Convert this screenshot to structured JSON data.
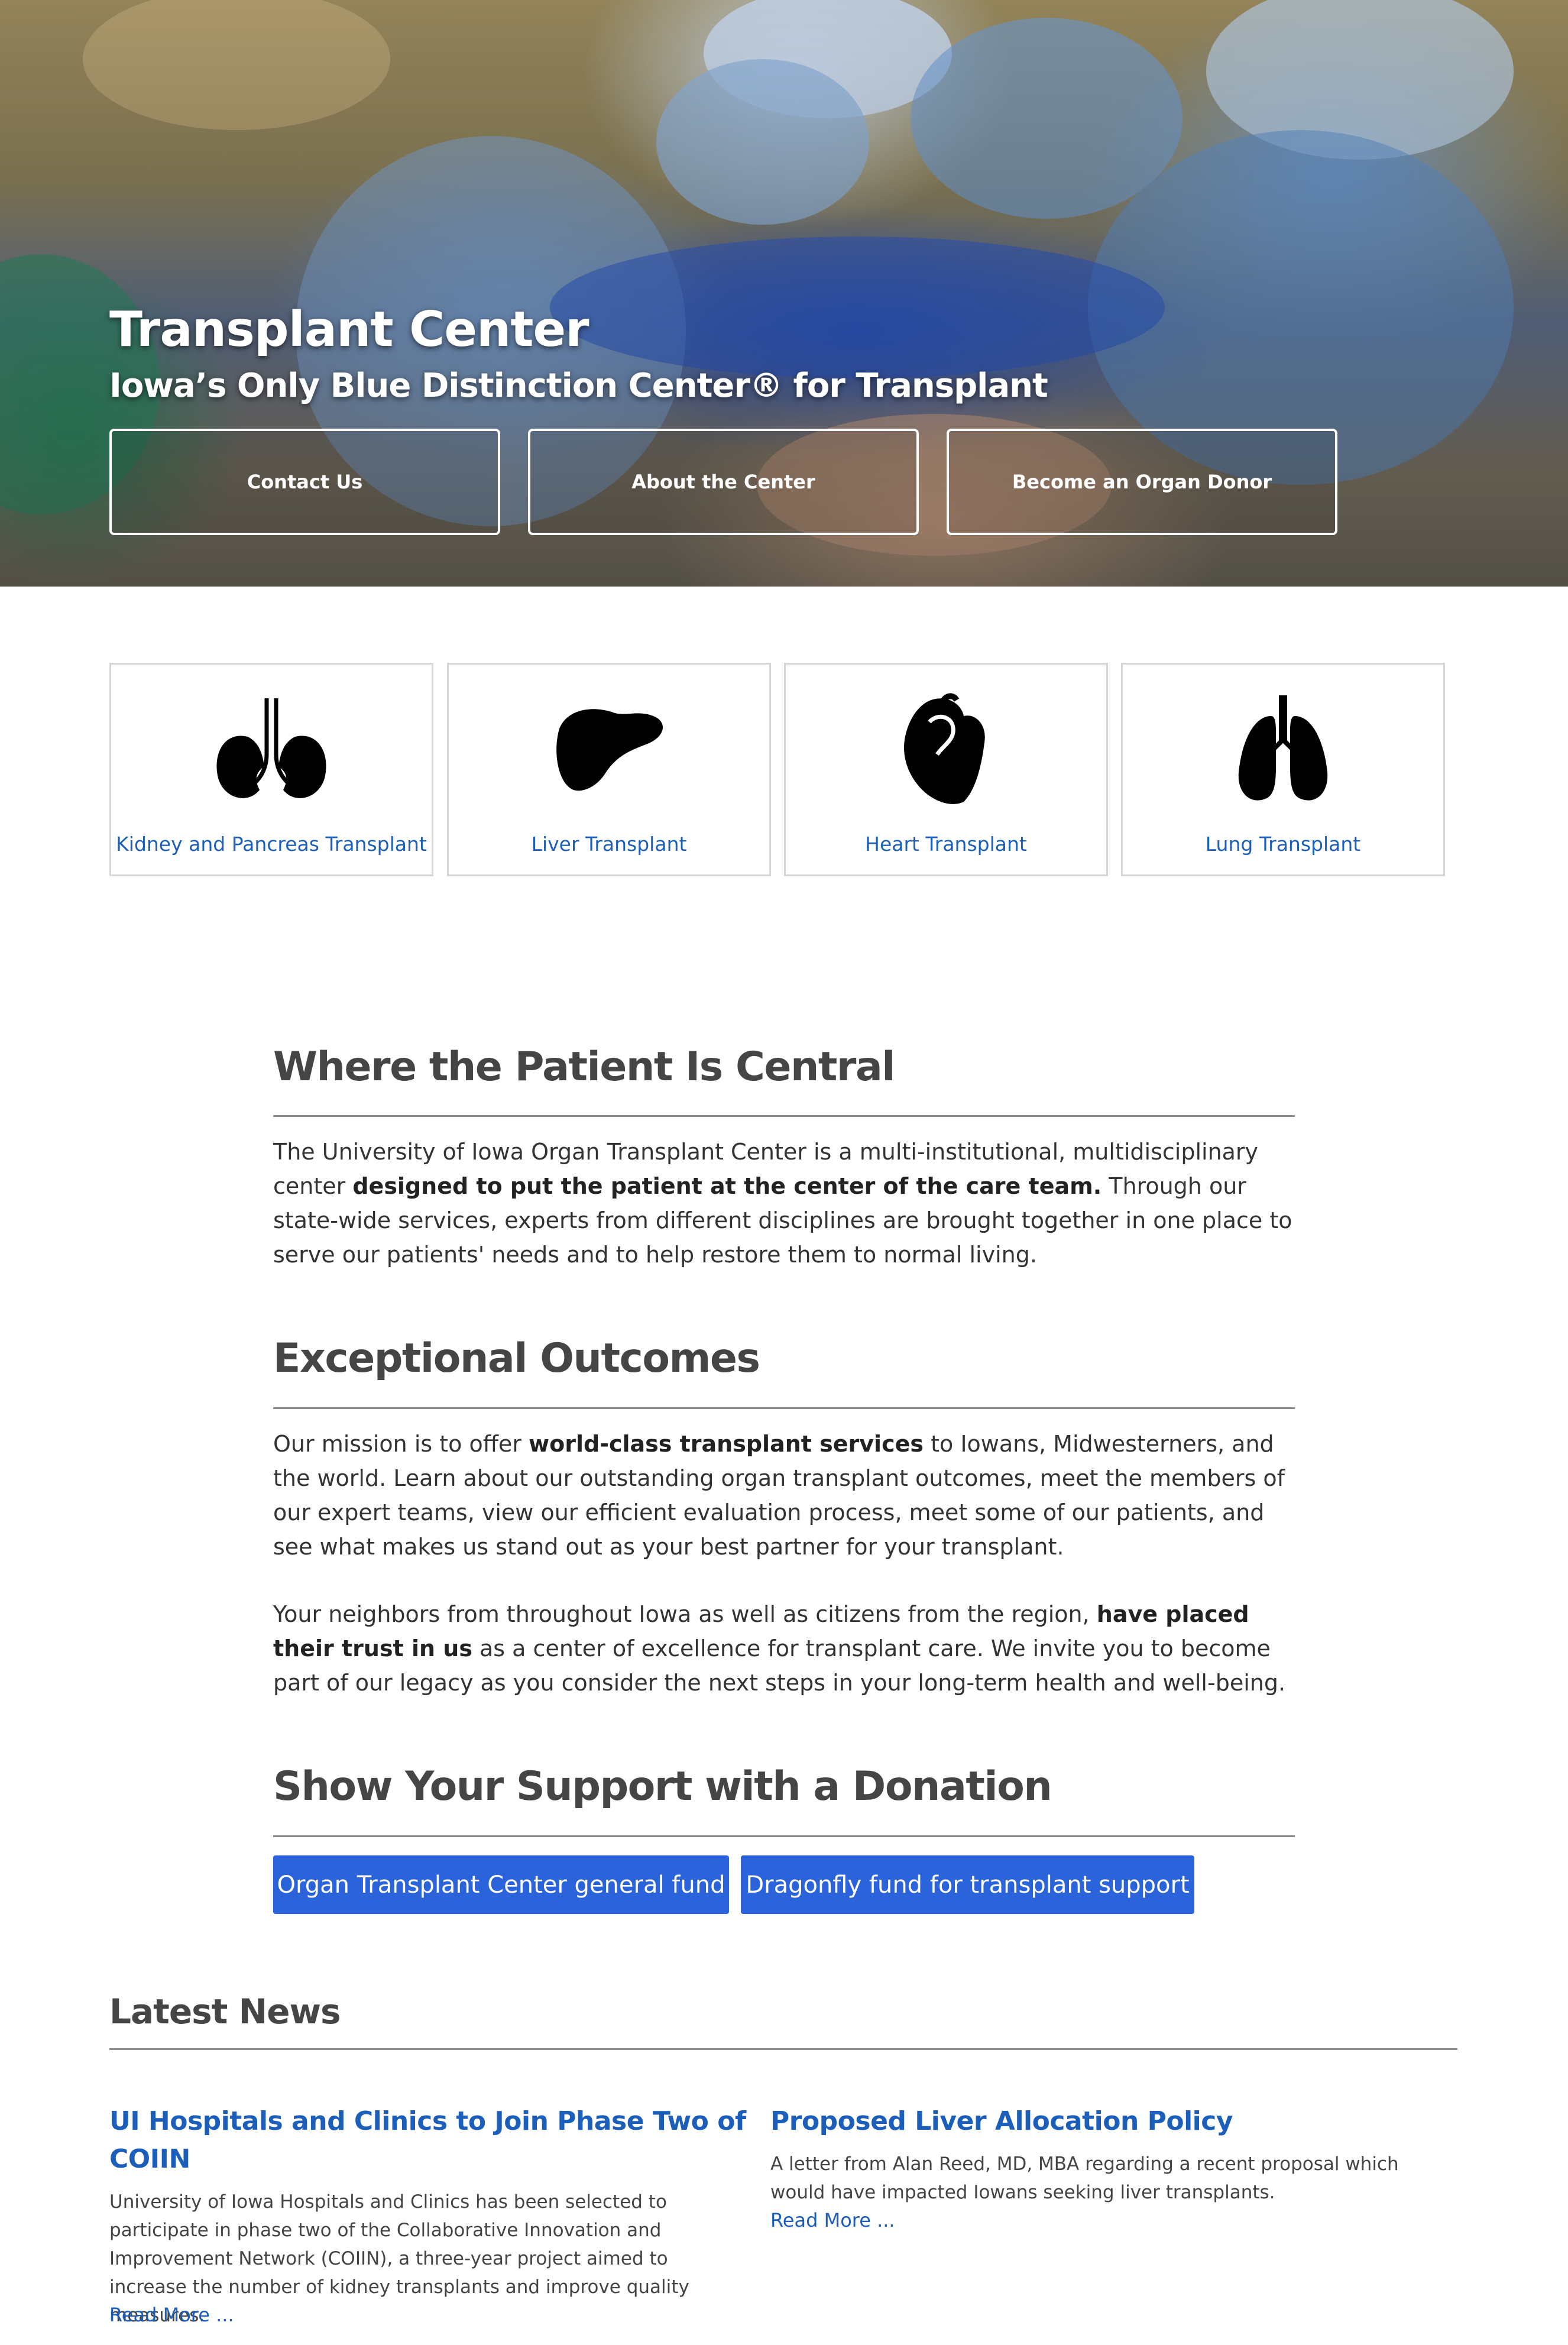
{
  "hero": {
    "title": "Transplant Center",
    "subtitle": "Iowa’s Only Blue Distinction Center® for Transplant",
    "buttons": [
      "Contact Us",
      "About the Center",
      "Become an Organ Donor"
    ]
  },
  "organs": [
    {
      "label": "Kidney and Pancreas Transplant",
      "icon": "kidney-icon"
    },
    {
      "label": "Liver Transplant",
      "icon": "liver-icon"
    },
    {
      "label": "Heart Transplant",
      "icon": "heart-icon"
    },
    {
      "label": "Lung Transplant",
      "icon": "lung-icon"
    }
  ],
  "sections": {
    "patient": {
      "heading": "Where the Patient Is Central",
      "p1_a": "The University of Iowa Organ Transplant Center is a multi-institutional, multidisciplinary center ",
      "p1_b": "designed to put the patient at the center of the care team.",
      "p1_c": " Through our state-wide services, experts from different disciplines are brought together in one place to serve our patients' needs and to help restore them to normal living."
    },
    "outcomes": {
      "heading": "Exceptional Outcomes",
      "p1_a": "Our mission is to offer ",
      "p1_b": "world-class transplant services",
      "p1_c": " to Iowans, Midwesterners, and the world. Learn about our outstanding organ transplant outcomes, meet the members of our expert teams, view our efficient evaluation process, meet some of our patients, and see what makes us stand out as your best partner for your transplant.",
      "p2_a": "Your neighbors from throughout Iowa as well as citizens from the region, ",
      "p2_b": "have placed their trust in us",
      "p2_c": " as a center of excellence for transplant care. We invite you to become part of our legacy as you consider the next steps in your long-term health and well-being."
    },
    "donation": {
      "heading": "Show Your Support with a Donation",
      "buttons": [
        "Organ Transplant Center general fund",
        "Dragonfly fund for transplant support"
      ]
    }
  },
  "news": {
    "heading": "Latest News",
    "items": [
      {
        "title": "UI Hospitals and Clinics to Join Phase Two of COIIN",
        "summary": "University of Iowa Hospitals and Clinics has been selected to participate in phase two of the Collaborative Innovation and Improvement Network (COIIN), a three-year project aimed to increase the number of kidney transplants and improve quality measures.",
        "read_more": "Read More ..."
      },
      {
        "title": "Proposed Liver Allocation Policy",
        "summary": "A letter from Alan Reed, MD, MBA regarding a recent proposal which would have impacted Iowans seeking liver transplants.",
        "read_more": "Read More ..."
      }
    ]
  },
  "colors": {
    "link": "#1b5fba",
    "button": "#2b63da",
    "heading": "#454545"
  }
}
